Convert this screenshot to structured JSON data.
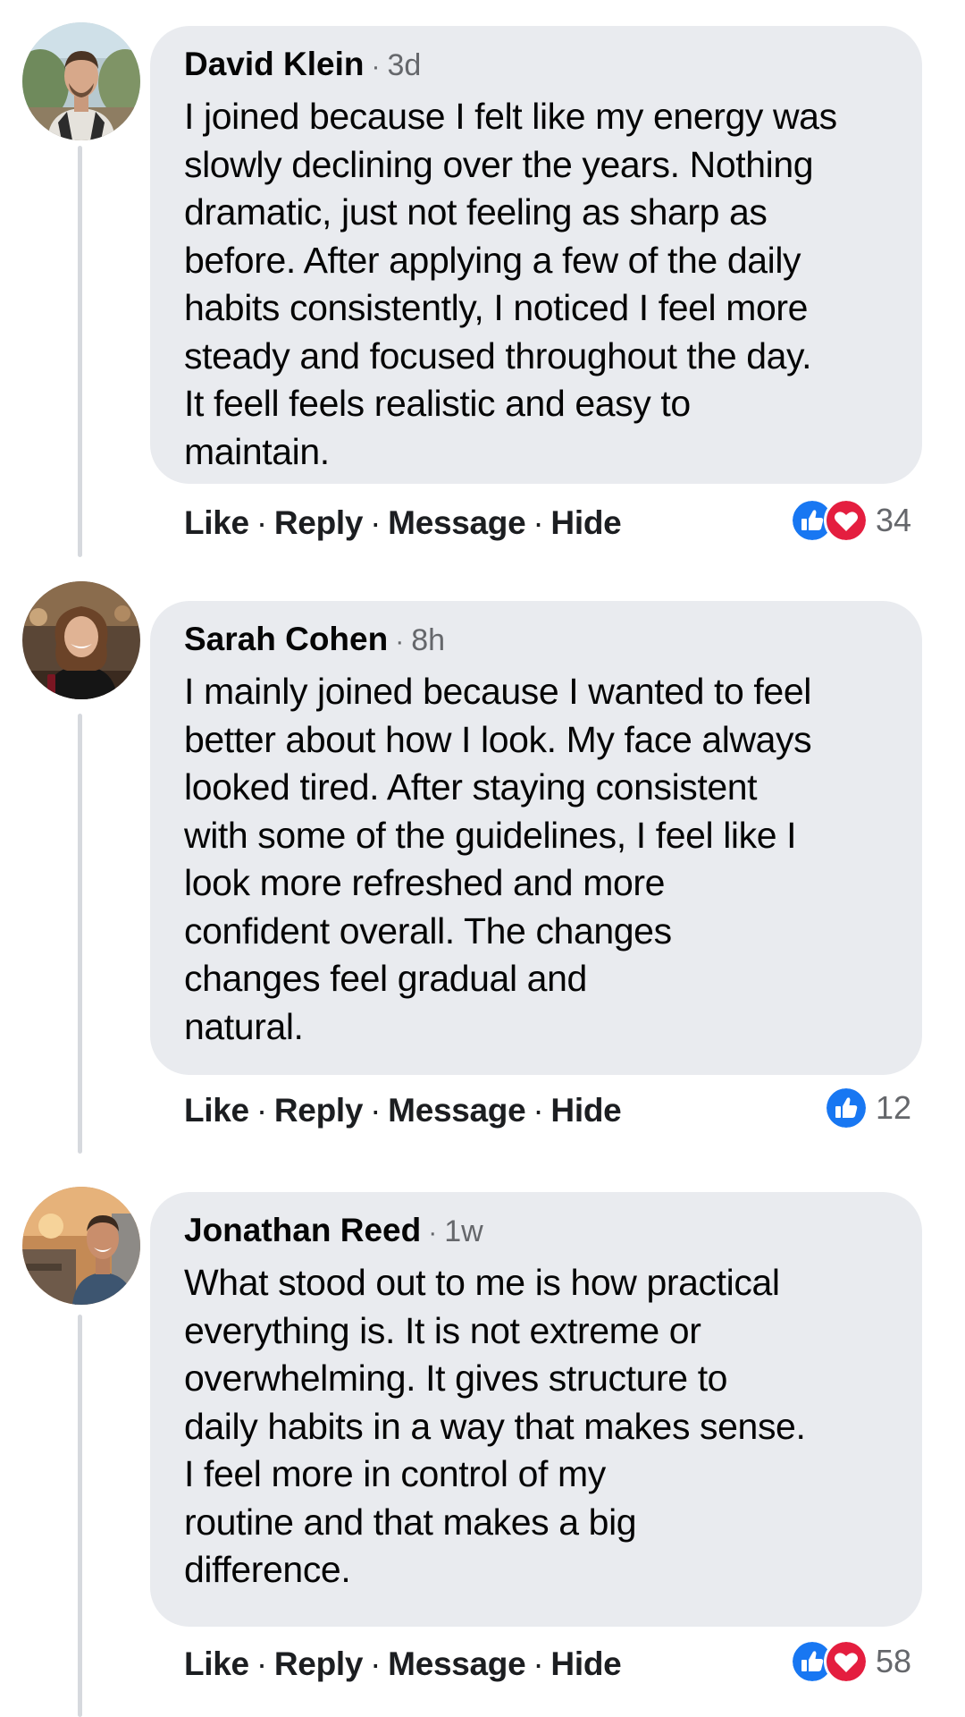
{
  "colors": {
    "bubble": "#e9ebef",
    "like_blue": "#1877f2",
    "love_red": "#e41e3f",
    "meta_gray": "#65676b",
    "thread_line": "#d6d9de"
  },
  "comments": [
    {
      "author": "David Klein",
      "time": "3d",
      "text": "I joined because I felt like my energy was\nslowly declining over the years. Nothing\ndramatic, just not feeling as sharp as\nbefore. After applying a few of the daily\nhabits consistently, I noticed I feel more\nsteady and focused throughout the day.\nIt feell feels realistic and easy to\nmaintain.",
      "actions": {
        "like": "Like",
        "reply": "Reply",
        "message": "Message",
        "hide": "Hide"
      },
      "reactions": [
        "like-icon",
        "love-icon"
      ],
      "reaction_count": "34"
    },
    {
      "author": "Sarah Cohen",
      "time": "8h",
      "text": "I mainly joined because I wanted to feel\nbetter about how I look. My face always\nlooked tired. After staying consistent\nwith some of the guidelines, I feel like I\nlook more refreshed and more\nconfident overall. The changes\nchanges feel gradual and\nnatural.",
      "actions": {
        "like": "Like",
        "reply": "Reply",
        "message": "Message",
        "hide": "Hide"
      },
      "reactions": [
        "like-icon"
      ],
      "reaction_count": "12"
    },
    {
      "author": "Jonathan Reed",
      "time": "1w",
      "text": "What stood out to me is how practical\neverything is. It is not extreme or\noverwhelming. It gives structure to\ndaily habits in a way that makes sense.\nI feel more in control of my\nroutine and that makes a big\ndifference.",
      "actions": {
        "like": "Like",
        "reply": "Reply",
        "message": "Message",
        "hide": "Hide"
      },
      "reactions": [
        "like-icon",
        "love-icon"
      ],
      "reaction_count": "58"
    }
  ]
}
